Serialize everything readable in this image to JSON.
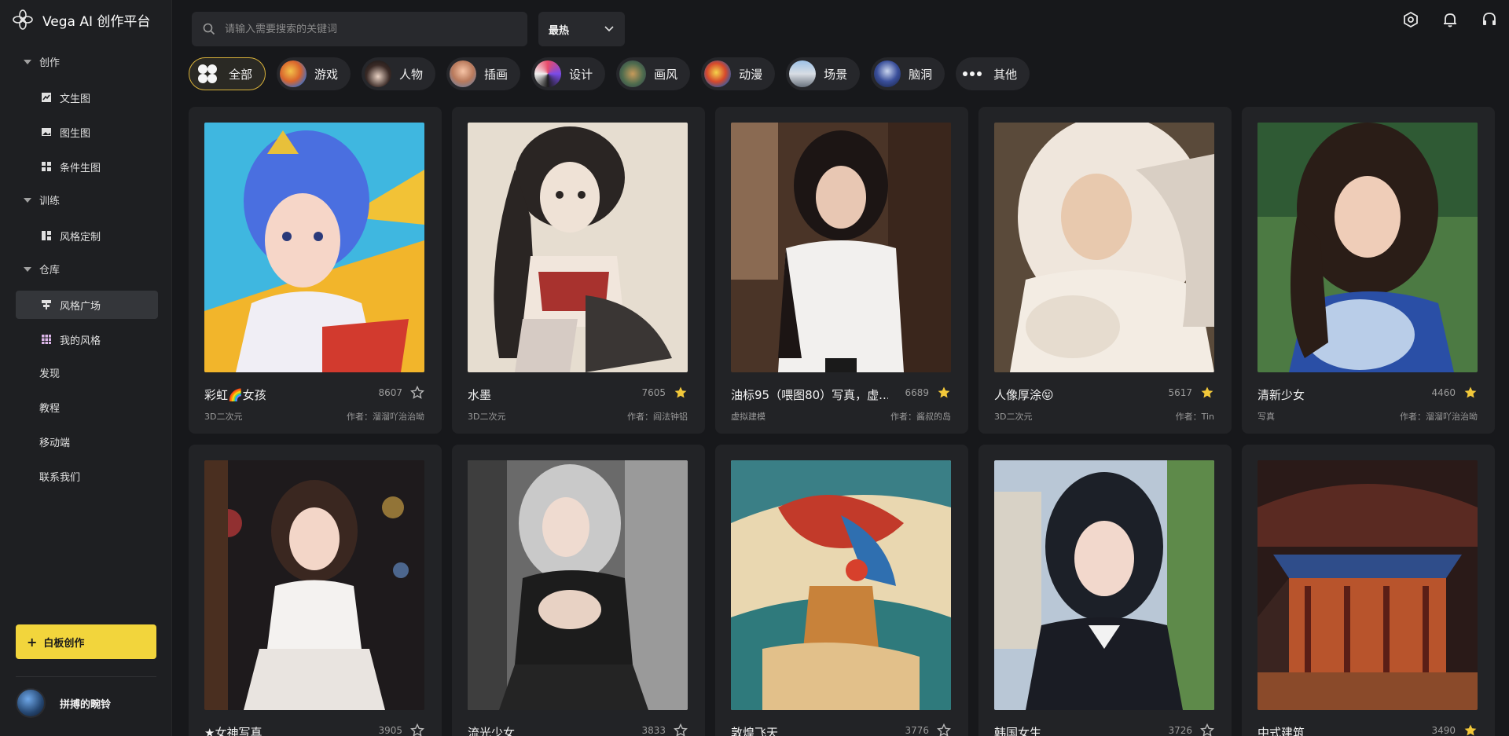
{
  "app": {
    "title": "Vega AI 创作平台"
  },
  "sidebar": {
    "groups": [
      {
        "label": "创作",
        "items": [
          "文生图",
          "图生图",
          "条件生图"
        ]
      },
      {
        "label": "训练",
        "items": [
          "风格定制"
        ]
      },
      {
        "label": "仓库",
        "items": [
          "风格广场",
          "我的风格"
        ]
      }
    ],
    "links": [
      "发现",
      "教程",
      "移动端",
      "联系我们"
    ],
    "board_button": "白板创作",
    "user_name": "拼搏的畹铃"
  },
  "search": {
    "placeholder": "请输入需要搜索的关键词"
  },
  "sort": {
    "value": "最热"
  },
  "categories": [
    "全部",
    "游戏",
    "人物",
    "插画",
    "设计",
    "画风",
    "动漫",
    "场景",
    "脑洞",
    "其他"
  ],
  "cards": [
    {
      "title": "彩虹🌈女孩",
      "count": "8607",
      "category": "3D二次元",
      "author": "作者：溜溜吖治治呦",
      "starred": false
    },
    {
      "title": "水墨",
      "count": "7605",
      "category": "3D二次元",
      "author": "作者：阎法钟铝",
      "starred": true
    },
    {
      "title": "油标95（喂图80）写真，虚...",
      "count": "6689",
      "category": "虚拟建模",
      "author": "作者：酱叔的岛",
      "starred": true
    },
    {
      "title": "人像厚涂😝",
      "count": "5617",
      "category": "3D二次元",
      "author": "作者：Tin",
      "starred": true
    },
    {
      "title": "清新少女",
      "count": "4460",
      "category": "写真",
      "author": "作者：溜溜吖治治呦",
      "starred": true
    },
    {
      "title": "★女神写真",
      "count": "3905",
      "category": "",
      "author": "",
      "starred": false
    },
    {
      "title": "流光少女",
      "count": "3833",
      "category": "",
      "author": "",
      "starred": false
    },
    {
      "title": "敦煌飞天",
      "count": "3776",
      "category": "",
      "author": "",
      "starred": false
    },
    {
      "title": "韩国女生",
      "count": "3726",
      "category": "",
      "author": "",
      "starred": false
    },
    {
      "title": "中式建筑",
      "count": "3490",
      "category": "",
      "author": "",
      "starred": true
    }
  ],
  "colors": {
    "accent": "#f2d53c",
    "background": "#17181b",
    "card": "#222326"
  }
}
